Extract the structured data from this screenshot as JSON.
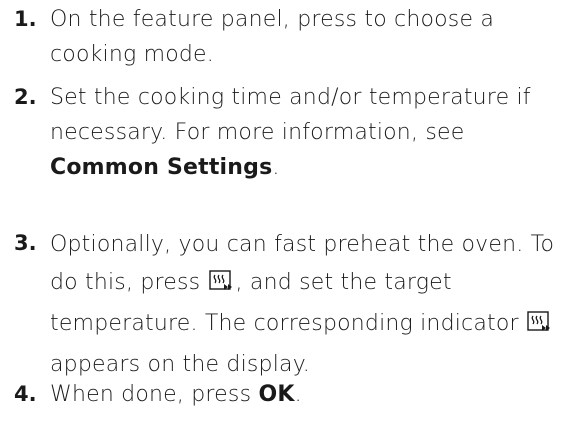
{
  "steps": [
    {
      "number": "1.",
      "text": "On the feature panel, press to choose a cooking mode."
    },
    {
      "number": "2.",
      "text_before": "Set the cooking time and/or temperature if necessary. For more information, see ",
      "link": "Common Settings",
      "text_after": "."
    },
    {
      "number": "3.",
      "text_part1": "Optionally, you can fast preheat the oven. To do this, press ",
      "icon1": "fast-preheat-icon",
      "text_part2": ", and set the target temperature. The corresponding indicator ",
      "icon2": "fast-preheat-icon",
      "text_part3": " appears on the display."
    },
    {
      "number": "4.",
      "text_before": "When done, press ",
      "bold": "OK",
      "text_after": "."
    }
  ]
}
